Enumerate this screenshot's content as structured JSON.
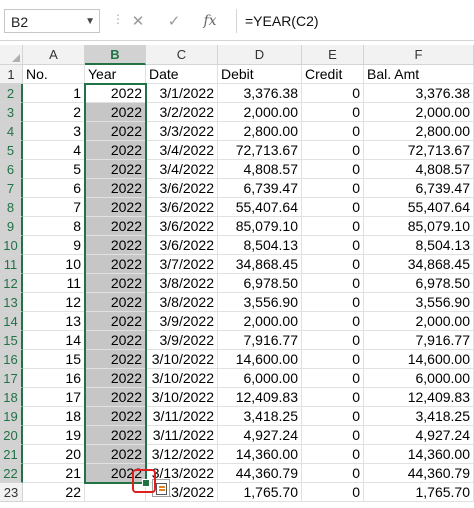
{
  "formula_bar": {
    "name_box": "B2",
    "cancel_icon": "✕",
    "enter_icon": "✓",
    "fx_label": "fx",
    "formula": "=YEAR(C2)"
  },
  "columns": [
    "A",
    "B",
    "C",
    "D",
    "E",
    "F"
  ],
  "rows": [
    {
      "n": "1",
      "cells": [
        "No.",
        "Year",
        "Date",
        "Debit",
        "Credit",
        "Bal. Amt"
      ]
    },
    {
      "n": "2",
      "cells": [
        "1",
        "2022",
        "3/1/2022",
        "3,376.38",
        "0",
        "3,376.38"
      ]
    },
    {
      "n": "3",
      "cells": [
        "2",
        "2022",
        "3/2/2022",
        "2,000.00",
        "0",
        "2,000.00"
      ]
    },
    {
      "n": "4",
      "cells": [
        "3",
        "2022",
        "3/3/2022",
        "2,800.00",
        "0",
        "2,800.00"
      ]
    },
    {
      "n": "5",
      "cells": [
        "4",
        "2022",
        "3/4/2022",
        "72,713.67",
        "0",
        "72,713.67"
      ]
    },
    {
      "n": "6",
      "cells": [
        "5",
        "2022",
        "3/4/2022",
        "4,808.57",
        "0",
        "4,808.57"
      ]
    },
    {
      "n": "7",
      "cells": [
        "6",
        "2022",
        "3/6/2022",
        "6,739.47",
        "0",
        "6,739.47"
      ]
    },
    {
      "n": "8",
      "cells": [
        "7",
        "2022",
        "3/6/2022",
        "55,407.64",
        "0",
        "55,407.64"
      ]
    },
    {
      "n": "9",
      "cells": [
        "8",
        "2022",
        "3/6/2022",
        "85,079.10",
        "0",
        "85,079.10"
      ]
    },
    {
      "n": "10",
      "cells": [
        "9",
        "2022",
        "3/6/2022",
        "8,504.13",
        "0",
        "8,504.13"
      ]
    },
    {
      "n": "11",
      "cells": [
        "10",
        "2022",
        "3/7/2022",
        "34,868.45",
        "0",
        "34,868.45"
      ]
    },
    {
      "n": "12",
      "cells": [
        "11",
        "2022",
        "3/8/2022",
        "6,978.50",
        "0",
        "6,978.50"
      ]
    },
    {
      "n": "13",
      "cells": [
        "12",
        "2022",
        "3/8/2022",
        "3,556.90",
        "0",
        "3,556.90"
      ]
    },
    {
      "n": "14",
      "cells": [
        "13",
        "2022",
        "3/9/2022",
        "2,000.00",
        "0",
        "2,000.00"
      ]
    },
    {
      "n": "15",
      "cells": [
        "14",
        "2022",
        "3/9/2022",
        "7,916.77",
        "0",
        "7,916.77"
      ]
    },
    {
      "n": "16",
      "cells": [
        "15",
        "2022",
        "3/10/2022",
        "14,600.00",
        "0",
        "14,600.00"
      ]
    },
    {
      "n": "17",
      "cells": [
        "16",
        "2022",
        "3/10/2022",
        "6,000.00",
        "0",
        "6,000.00"
      ]
    },
    {
      "n": "18",
      "cells": [
        "17",
        "2022",
        "3/10/2022",
        "12,409.83",
        "0",
        "12,409.83"
      ]
    },
    {
      "n": "19",
      "cells": [
        "18",
        "2022",
        "3/11/2022",
        "3,418.25",
        "0",
        "3,418.25"
      ]
    },
    {
      "n": "20",
      "cells": [
        "19",
        "2022",
        "3/11/2022",
        "4,927.24",
        "0",
        "4,927.24"
      ]
    },
    {
      "n": "21",
      "cells": [
        "20",
        "2022",
        "3/12/2022",
        "14,360.00",
        "0",
        "14,360.00"
      ]
    },
    {
      "n": "22",
      "cells": [
        "21",
        "2022",
        "3/13/2022",
        "44,360.79",
        "0",
        "44,360.79"
      ]
    },
    {
      "n": "23",
      "cells": [
        "22",
        "",
        "13/2022",
        "1,765.70",
        "0",
        "1,765.70"
      ]
    }
  ],
  "colors": {
    "accent": "#217346",
    "selection": "#c6c6c6",
    "callout": "#e02020"
  }
}
